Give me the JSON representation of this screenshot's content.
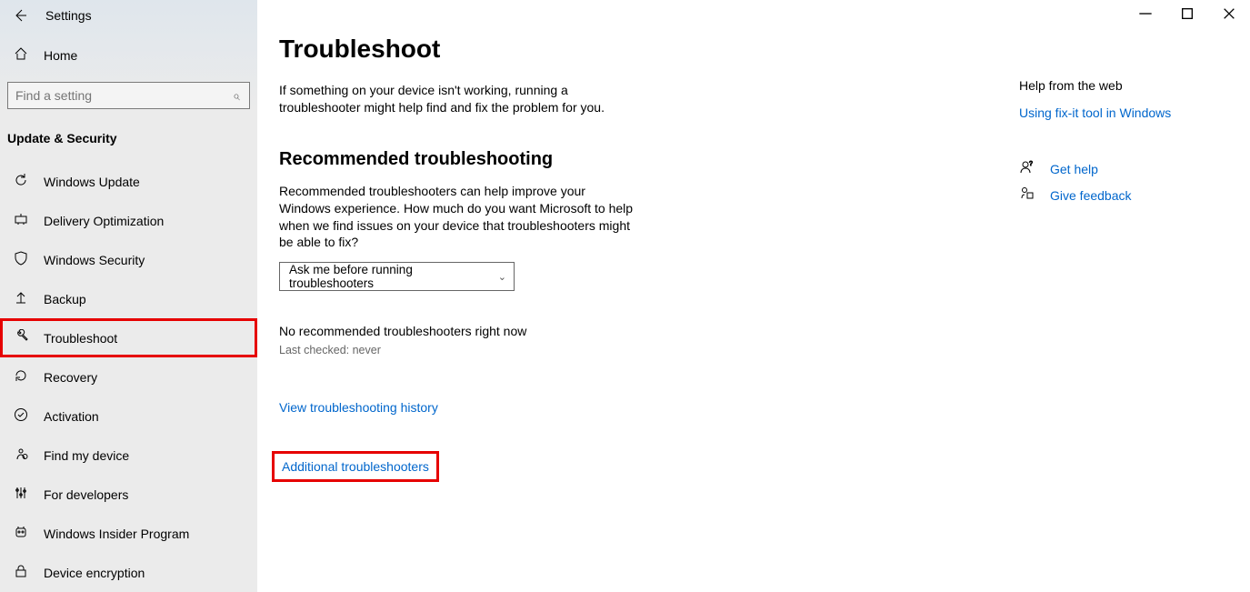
{
  "window": {
    "title": "Settings"
  },
  "sidebar": {
    "home": "Home",
    "search_placeholder": "Find a setting",
    "category": "Update & Security",
    "items": [
      {
        "label": "Windows Update",
        "icon": "refresh-icon",
        "highlight": false
      },
      {
        "label": "Delivery Optimization",
        "icon": "delivery-icon",
        "highlight": false
      },
      {
        "label": "Windows Security",
        "icon": "shield-icon",
        "highlight": false
      },
      {
        "label": "Backup",
        "icon": "backup-icon",
        "highlight": false
      },
      {
        "label": "Troubleshoot",
        "icon": "wrench-icon",
        "highlight": true
      },
      {
        "label": "Recovery",
        "icon": "recovery-icon",
        "highlight": false
      },
      {
        "label": "Activation",
        "icon": "check-icon",
        "highlight": false
      },
      {
        "label": "Find my device",
        "icon": "location-icon",
        "highlight": false
      },
      {
        "label": "For developers",
        "icon": "tools-icon",
        "highlight": false
      },
      {
        "label": "Windows Insider Program",
        "icon": "insider-icon",
        "highlight": false
      },
      {
        "label": "Device encryption",
        "icon": "lock-icon",
        "highlight": false
      }
    ]
  },
  "main": {
    "title": "Troubleshoot",
    "intro": "If something on your device isn't working, running a troubleshooter might help find and fix the problem for you.",
    "section_heading": "Recommended troubleshooting",
    "section_desc": "Recommended troubleshooters can help improve your Windows experience. How much do you want Microsoft to help when we find issues on your device that troubleshooters might be able to fix?",
    "dropdown_value": "Ask me before running troubleshooters",
    "status_line": "No recommended troubleshooters right now",
    "status_sub": "Last checked: never",
    "history_link": "View troubleshooting history",
    "additional_link": "Additional troubleshooters"
  },
  "help": {
    "heading": "Help from the web",
    "web_link": "Using fix-it tool in Windows",
    "get_help": "Get help",
    "give_feedback": "Give feedback"
  }
}
